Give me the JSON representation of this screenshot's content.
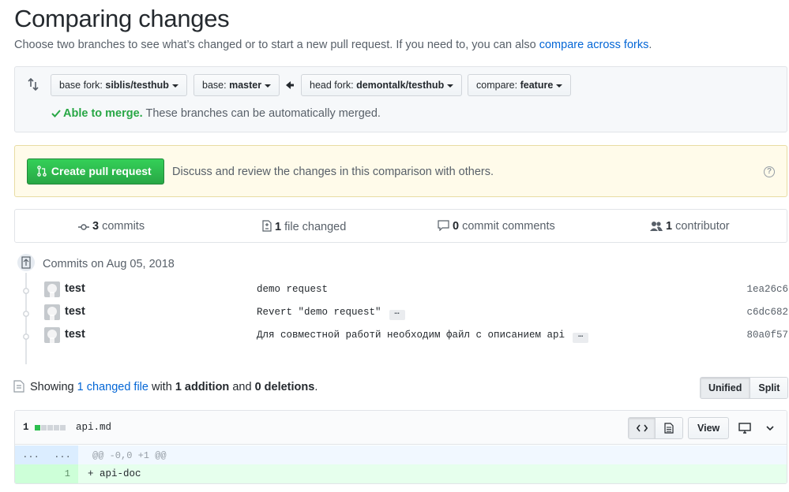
{
  "page": {
    "title": "Comparing changes",
    "subtitle": "Choose two branches to see what’s changed or to start a new pull request. If you need to, you can also",
    "subtitle_link": "compare across forks",
    "subtitle_end": "."
  },
  "range": {
    "base_fork_label": "base fork:",
    "base_fork_value": "siblis/testhub",
    "base_label": "base:",
    "base_value": "master",
    "head_fork_label": "head fork:",
    "head_fork_value": "demontalk/testhub",
    "compare_label": "compare:",
    "compare_value": "feature",
    "merge_ok": "Able to merge.",
    "merge_text": "These branches can be automatically merged."
  },
  "pr": {
    "button_label": "Create pull request",
    "description": "Discuss and review the changes in this comparison with others.",
    "help": "?"
  },
  "summary": {
    "commits_count": "3",
    "commits_label": "commits",
    "files_count": "1",
    "files_label": "file changed",
    "comments_count": "0",
    "comments_label": "commit comments",
    "contributors_count": "1",
    "contributors_label": "contributor"
  },
  "commits": {
    "heading": "Commits on Aug 05, 2018",
    "items": [
      {
        "author": "test",
        "message": "demo request",
        "sha": "1ea26c6",
        "has_more": false
      },
      {
        "author": "test",
        "message": "Revert \"demo request\"",
        "sha": "c6dc682",
        "has_more": true
      },
      {
        "author": "test",
        "message": "Для совместной работй необходим файл с описанием api",
        "sha": "80a0f57",
        "has_more": true
      }
    ],
    "more_label": "…"
  },
  "files": {
    "showing": "Showing",
    "changed_link": "1 changed file",
    "with": "with",
    "additions": "1 addition",
    "and": "and",
    "deletions": "0 deletions",
    "end": ".",
    "unified_label": "Unified",
    "split_label": "Split"
  },
  "diff": {
    "count": "1",
    "diffstat": {
      "added_blocks": 1,
      "total_blocks": 5
    },
    "file_name": "api.md",
    "view_label": "View",
    "hunk_left": "...",
    "hunk_right": "...",
    "hunk_header": "@@ -0,0 +1 @@",
    "add_line_number": "1",
    "add_line": "+ api-doc"
  },
  "colors": {
    "accent_link": "#0366d6",
    "success": "#28a745",
    "pr_banner": "#fffbea",
    "addition_bg": "#e6ffed"
  }
}
